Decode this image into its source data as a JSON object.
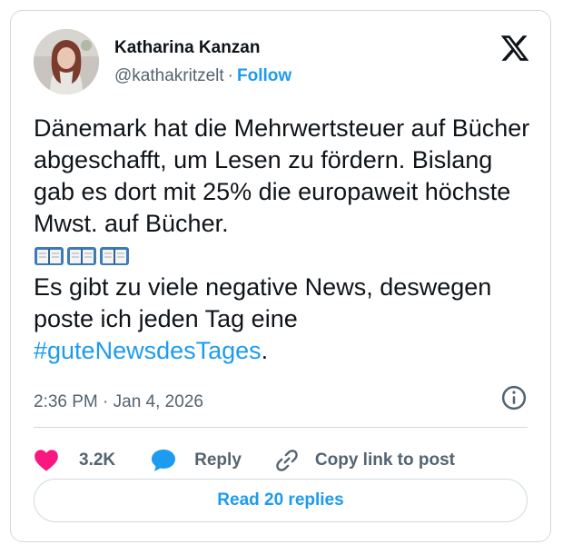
{
  "author": {
    "name": "Katharina Kanzan",
    "handle": "@kathakritzelt",
    "separator": "·",
    "follow_label": "Follow"
  },
  "tweet": {
    "text_part1": "Dänemark hat die Mehrwertsteuer auf Bücher abgeschafft, um Lesen zu fördern. Bislang gab es dort mit 25% die europaweit höchste Mwst. auf Bücher.",
    "emoji_icons": [
      "open-book-icon",
      "open-book-icon",
      "open-book-icon"
    ],
    "text_part2": "Es gibt zu viele negative News, deswegen poste ich jeden Tag eine ",
    "hashtag": "#guteNewsdesTages",
    "text_end": "."
  },
  "meta": {
    "timestamp": "2:36 PM · Jan 4, 2026"
  },
  "actions": {
    "like_count": "3.2K",
    "reply_label": "Reply",
    "copy_label": "Copy link to post"
  },
  "footer": {
    "read_replies_label": "Read 20 replies"
  },
  "colors": {
    "accent": "#1d9bf0",
    "heart": "#f91880",
    "text": "#0f1419",
    "muted": "#536471",
    "border": "#cfd9de"
  }
}
